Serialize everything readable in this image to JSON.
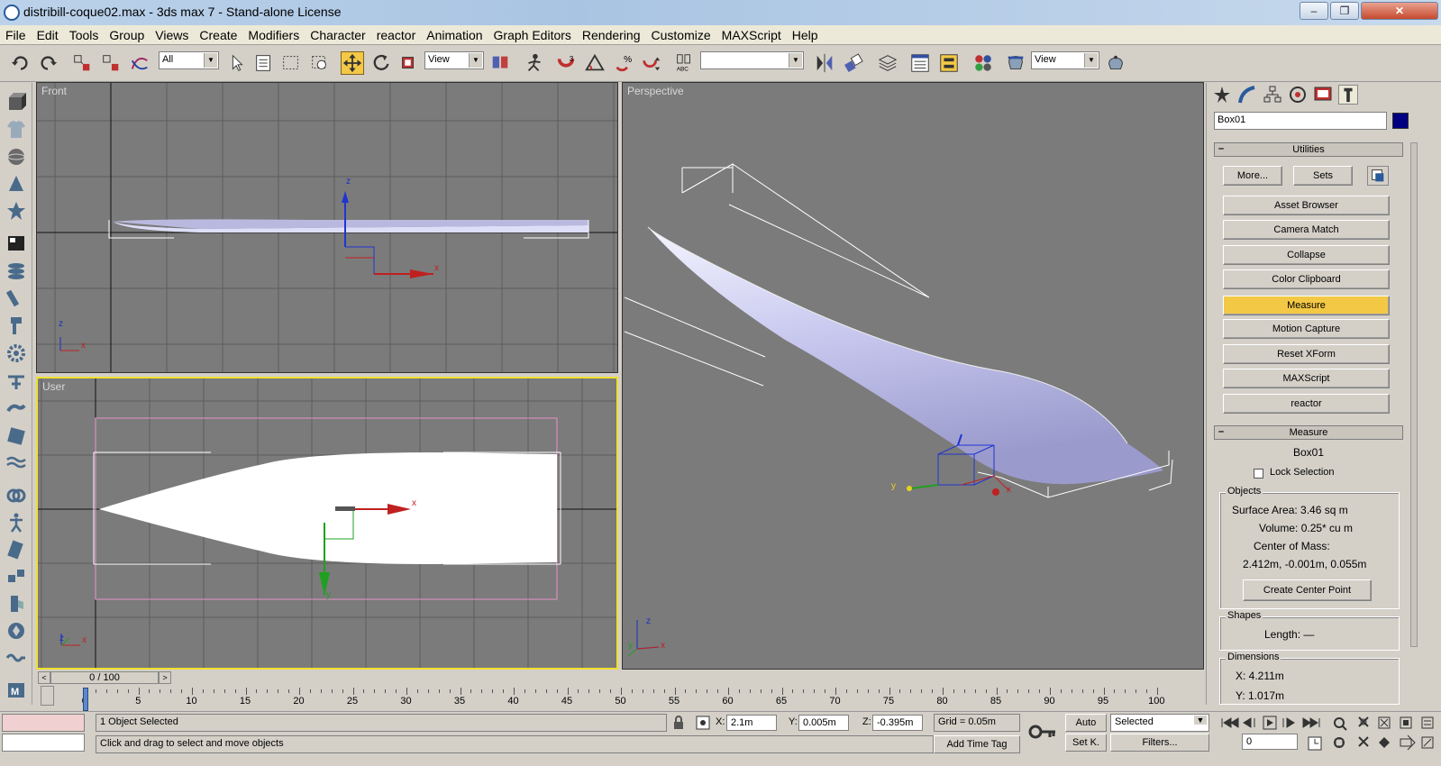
{
  "window": {
    "title": "distribill-coque02.max - 3ds max 7  - Stand-alone License",
    "min": "–",
    "max": "❐",
    "close": "✕"
  },
  "menu": [
    "File",
    "Edit",
    "Tools",
    "Group",
    "Views",
    "Create",
    "Modifiers",
    "Character",
    "reactor",
    "Animation",
    "Graph Editors",
    "Rendering",
    "Customize",
    "MAXScript",
    "Help"
  ],
  "toolbar": {
    "selection_filter": "All",
    "ref_coord": "View",
    "render_view": "View",
    "named_sel": ""
  },
  "viewports": {
    "front": "Front",
    "perspective": "Perspective",
    "user": "User"
  },
  "axis": {
    "x": "x",
    "y": "y",
    "z": "z"
  },
  "panel": {
    "object_name": "Box01",
    "object_color": "#000080",
    "utilities_title": "Utilities",
    "more": "More...",
    "sets": "Sets",
    "utilities": [
      "Asset Browser",
      "Camera Match",
      "Collapse",
      "Color Clipboard",
      "Measure",
      "Motion Capture",
      "Reset XForm",
      "MAXScript",
      "reactor"
    ],
    "active_utility": "Measure",
    "measure_title": "Measure",
    "measure_object": "Box01",
    "lock_selection": "Lock Selection",
    "objects_group": "Objects",
    "surface_area": "Surface Area:  3.46 sq m",
    "volume": "Volume:  0.25* cu m",
    "center_of_mass_label": "Center of Mass:",
    "center_of_mass": "2.412m, -0.001m, 0.055m",
    "create_center_point": "Create Center Point",
    "shapes_group": "Shapes",
    "length": "Length:  —",
    "dimensions_group": "Dimensions",
    "dim_x": "X:   4.211m",
    "dim_y": "Y:   1.017m"
  },
  "timeline": {
    "frame": "0 / 100",
    "ticks": [
      "0",
      "5",
      "10",
      "15",
      "20",
      "25",
      "30",
      "35",
      "40",
      "45",
      "50",
      "55",
      "60",
      "65",
      "70",
      "75",
      "80",
      "85",
      "90",
      "95",
      "100"
    ]
  },
  "status": {
    "selected": "1 Object Selected",
    "prompt": "Click and drag to select and move objects",
    "x_label": "X:",
    "x": "2.1m",
    "y_label": "Y:",
    "y": "0.005m",
    "z_label": "Z:",
    "z": "-0.395m",
    "grid": "Grid = 0.05m",
    "add_time_tag": "Add Time Tag",
    "auto": "Auto",
    "set_key": "Set K.",
    "key_filter": "Selected",
    "filters": "Filters...",
    "frame_field": "0"
  }
}
